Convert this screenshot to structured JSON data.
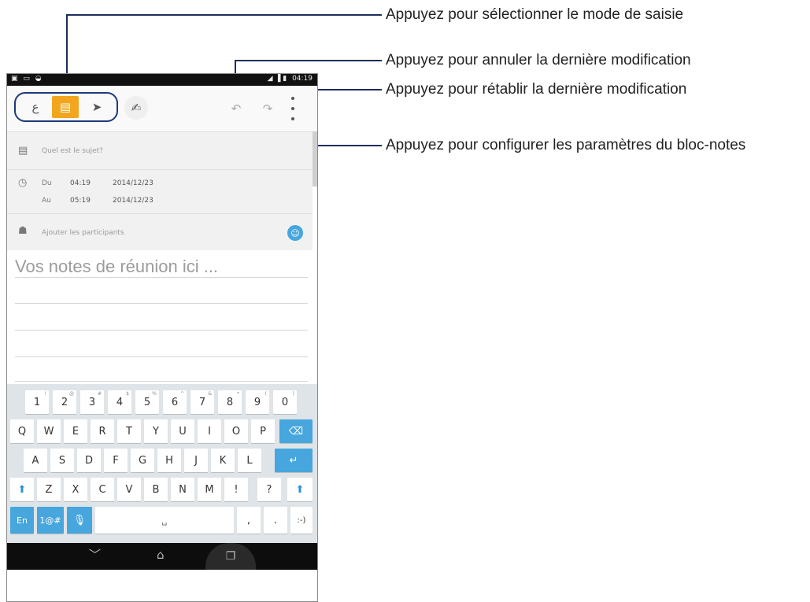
{
  "callouts": {
    "input_mode": "Appuyez pour sélectionner le mode de saisie",
    "undo": "Appuyez pour annuler la dernière modification",
    "redo": "Appuyez pour rétablir la dernière modification",
    "settings": "Appuyez pour configurer les paramètres du bloc-notes"
  },
  "status_bar": {
    "clock": "04:19"
  },
  "form": {
    "subject_placeholder": "Quel est le sujet?",
    "from_label": "Du",
    "from_time": "04:19",
    "from_date": "2014/12/23",
    "to_label": "Au",
    "to_time": "05:19",
    "to_date": "2014/12/23",
    "participants_placeholder": "Ajouter les participants",
    "notes_placeholder": "Vos notes de réunion ici ..."
  },
  "keyboard": {
    "row1": [
      "1",
      "2",
      "3",
      "4",
      "5",
      "6",
      "7",
      "8",
      "9",
      "0"
    ],
    "row1_hints": [
      "!",
      "@",
      "#",
      "$",
      "%",
      "^",
      "&",
      "*",
      "(",
      ")"
    ],
    "row2": [
      "Q",
      "W",
      "E",
      "R",
      "T",
      "Y",
      "U",
      "I",
      "O",
      "P"
    ],
    "row3": [
      "A",
      "S",
      "D",
      "F",
      "G",
      "H",
      "J",
      "K",
      "L"
    ],
    "row4": [
      "Z",
      "X",
      "C",
      "V",
      "B",
      "N",
      "M",
      "!",
      "?"
    ],
    "row5": {
      "lang": "En",
      "symbols": "1@#",
      "comma": ",",
      "period": ".",
      "smiley": ":-)"
    }
  },
  "colors": {
    "accent": "#f2a51e",
    "keyboard_blue": "#46a6dd",
    "callout_line": "#1c2f5c"
  }
}
